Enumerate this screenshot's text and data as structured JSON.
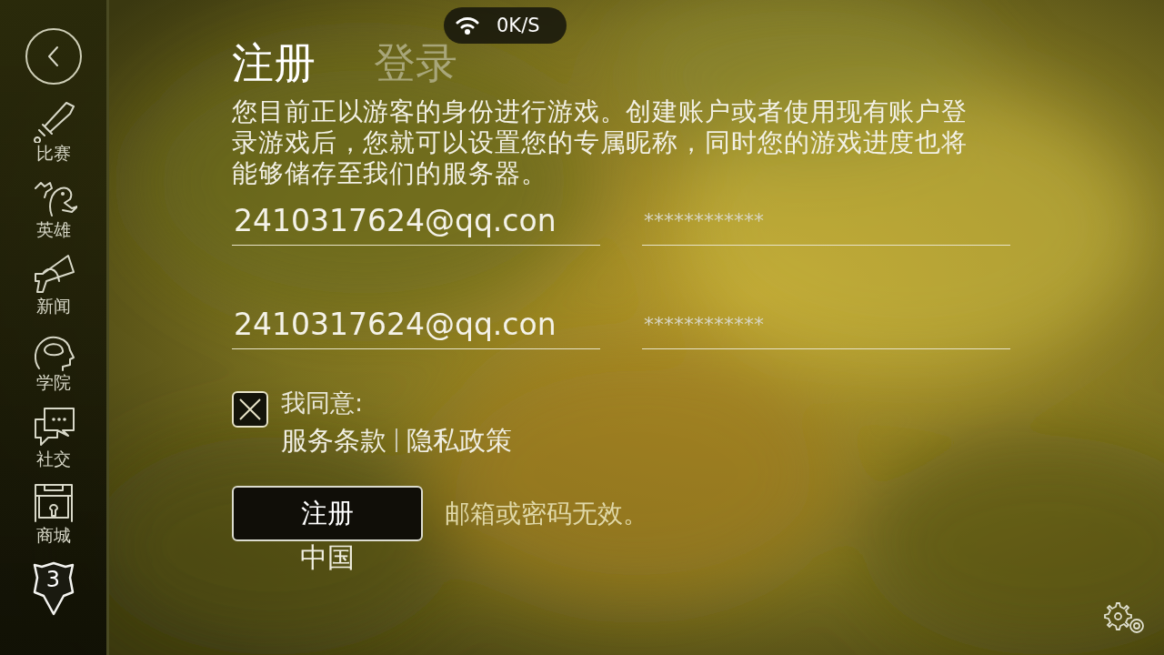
{
  "status_pill": {
    "speed": "0K/S"
  },
  "sidebar": {
    "items": [
      {
        "kind": "sword",
        "label": "比赛"
      },
      {
        "kind": "hero",
        "label": "英雄"
      },
      {
        "kind": "horn",
        "label": "新闻"
      },
      {
        "kind": "brain",
        "label": "学院"
      },
      {
        "kind": "chat",
        "label": "社交"
      },
      {
        "kind": "shop",
        "label": "商城"
      }
    ],
    "level_badge": "3"
  },
  "tabs": [
    {
      "label": "注册",
      "selected": true
    },
    {
      "label": "登录",
      "selected": false
    }
  ],
  "intro": "您目前正以游客的身份进行游戏。创建账户或者使用现有账户登录游戏后，您就可以设置您的专属昵称，同时您的游戏进度也将能够储存至我们的服务器。",
  "fields": [
    {
      "kind": "email",
      "value": "2410317624@qq.con"
    },
    {
      "kind": "password",
      "value": "************"
    },
    {
      "kind": "email",
      "value": "2410317624@qq.con"
    },
    {
      "kind": "password",
      "value": "************"
    }
  ],
  "agreement": {
    "checked": true,
    "label": "我同意:",
    "links": [
      "服务条款",
      "隐私政策"
    ]
  },
  "submit": {
    "label": "注册"
  },
  "error": "邮箱或密码无效。",
  "region": "中国"
}
